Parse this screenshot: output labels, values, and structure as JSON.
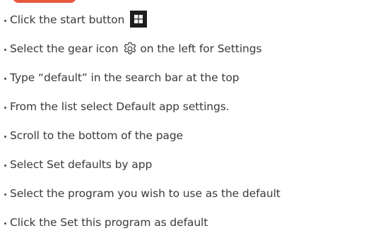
{
  "steps": [
    {
      "text": "Click the start button",
      "icon": "windows-logo-icon"
    },
    {
      "text_before": "Select the gear icon",
      "icon": "gear-icon",
      "text_after": "on the left for Settings"
    },
    {
      "text": "Type “default” in the search bar at the top"
    },
    {
      "text": "From the list select Default app settings."
    },
    {
      "text": "Scroll to the bottom of the page"
    },
    {
      "text": "Select Set defaults by app"
    },
    {
      "text": "Select the program you wish to use as the default"
    },
    {
      "text": "Click the Set this program as default"
    }
  ],
  "colors": {
    "text": "#3a3a3a",
    "accent": "#e9573f",
    "icon_dark": "#1e1e1e"
  }
}
